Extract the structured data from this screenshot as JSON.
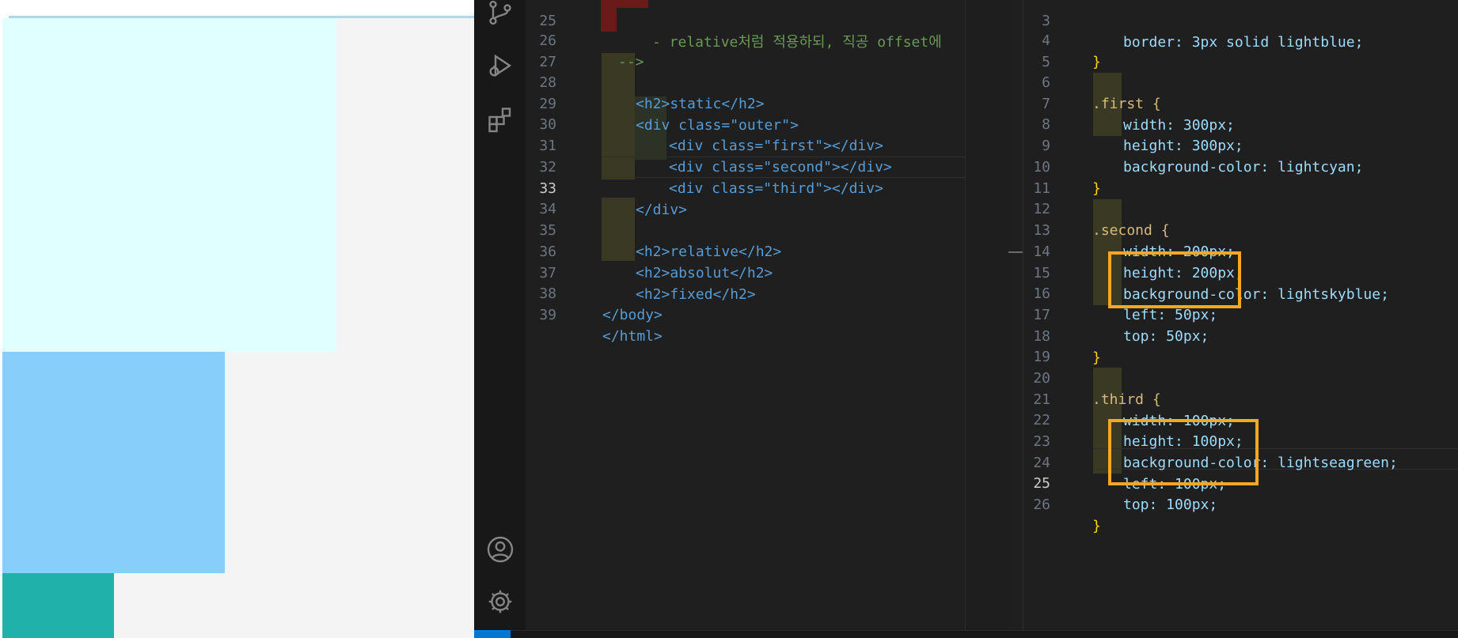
{
  "preview": {
    "boxes": [
      {
        "name": "first",
        "color": "#e0ffff"
      },
      {
        "name": "second",
        "color": "#87cefa"
      },
      {
        "name": "third",
        "color": "#20b2aa"
      }
    ],
    "outer_border_color": "#add8e6"
  },
  "activity_bar": {
    "icons": [
      "source-control-icon",
      "run-debug-icon",
      "extensions-icon",
      "account-icon",
      "settings-gear-icon"
    ]
  },
  "editor_html": {
    "lines": [
      {
        "n": "25",
        "text": "- relative처럼 적용하되, 직공 offset에"
      },
      {
        "n": "26",
        "text": "-->"
      },
      {
        "n": "27",
        "text": ""
      },
      {
        "n": "28",
        "text": "<h2>static</h2>"
      },
      {
        "n": "29",
        "text": "<div class=\"outer\">"
      },
      {
        "n": "30",
        "text": "<div class=\"first\"></div>"
      },
      {
        "n": "31",
        "text": "<div class=\"second\"></div>"
      },
      {
        "n": "32",
        "text": "<div class=\"third\"></div>"
      },
      {
        "n": "33",
        "text": "</div>"
      },
      {
        "n": "34",
        "text": ""
      },
      {
        "n": "35",
        "text": "<h2>relative</h2>"
      },
      {
        "n": "36",
        "text": "<h2>absolut</h2>"
      },
      {
        "n": "37",
        "text": "<h2>fixed</h2>"
      },
      {
        "n": "38",
        "text": "</body>"
      },
      {
        "n": "39",
        "text": "</html>"
      }
    ],
    "active_line": "33"
  },
  "editor_css": {
    "lines": [
      {
        "n": "3",
        "text": "border: 3px solid lightblue;"
      },
      {
        "n": "4",
        "text": "}"
      },
      {
        "n": "5",
        "text": ""
      },
      {
        "n": "6",
        "text": ".first {"
      },
      {
        "n": "7",
        "text": "width: 300px;"
      },
      {
        "n": "8",
        "text": "height: 300px;"
      },
      {
        "n": "9",
        "text": "background-color: lightcyan;"
      },
      {
        "n": "10",
        "text": "}"
      },
      {
        "n": "11",
        "text": ""
      },
      {
        "n": "12",
        "text": ".second {"
      },
      {
        "n": "13",
        "text": "width: 200px;"
      },
      {
        "n": "14",
        "text": "height: 200px;"
      },
      {
        "n": "15",
        "text": "background-color: lightskyblue;"
      },
      {
        "n": "16",
        "text": "left: 50px;"
      },
      {
        "n": "17",
        "text": "top: 50px;"
      },
      {
        "n": "18",
        "text": "}"
      },
      {
        "n": "19",
        "text": ""
      },
      {
        "n": "20",
        "text": ".third {"
      },
      {
        "n": "21",
        "text": "width: 100px;"
      },
      {
        "n": "22",
        "text": "height: 100px;"
      },
      {
        "n": "23",
        "text": "background-color: lightseagreen;"
      },
      {
        "n": "24",
        "text": "left: 100px;"
      },
      {
        "n": "25",
        "text": "top: 100px;"
      },
      {
        "n": "26",
        "text": "}"
      }
    ],
    "active_line": "25",
    "swatches": {
      "lightblue": "#add8e6",
      "lightcyan": "#e0ffff",
      "lightskyblue": "#87cefa",
      "lightseagreen": "#20b2aa"
    },
    "highlight_color": "#f5a623"
  },
  "theme": {
    "accent": "#0078d4",
    "editor_bg": "#1f1f1f"
  }
}
